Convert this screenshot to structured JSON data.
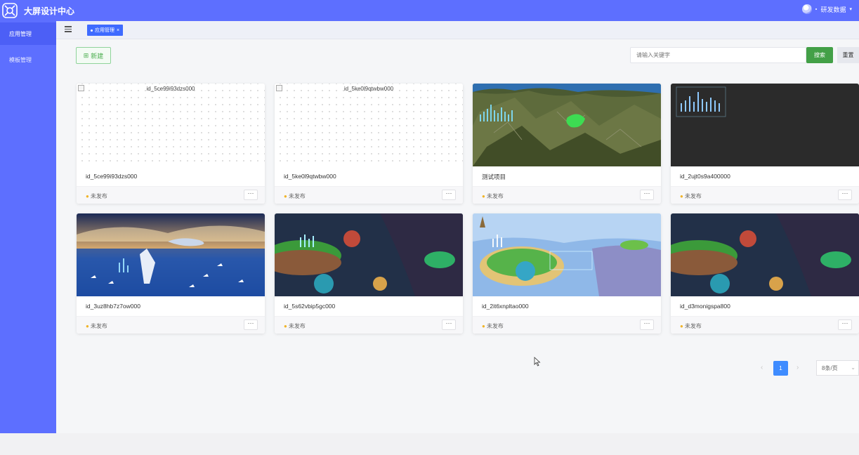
{
  "header": {
    "title": "大屏设计中心",
    "user_name": "研发数据"
  },
  "sidebar": {
    "items": [
      {
        "label": "应用管理",
        "active": true
      },
      {
        "label": "模板管理",
        "active": false
      }
    ]
  },
  "tabs": [
    {
      "label": "应用管理"
    }
  ],
  "toolbar": {
    "new_label": "新建",
    "search_placeholder": "请输入关键字",
    "search_label": "搜索",
    "reset_label": "重置"
  },
  "cards": [
    {
      "name": "id_5ce99i93dzs000",
      "alt": "id_5ce99i93dzs000",
      "status": "未发布",
      "thumb": "broken"
    },
    {
      "name": "id_5ke0l9qtwbw000",
      "alt": "id_5ke0l9qtwbw000",
      "status": "未发布",
      "thumb": "broken"
    },
    {
      "name": "测试项目",
      "status": "未发布",
      "thumb": "mountain"
    },
    {
      "name": "id_2ujt0s9a400000",
      "status": "未发布",
      "thumb": "dark-chart"
    },
    {
      "name": "id_3uz8hb7z7ow000",
      "status": "未发布",
      "thumb": "ocean"
    },
    {
      "name": "id_5s62vbip5gc000",
      "status": "未发布",
      "thumb": "fantasy-green"
    },
    {
      "name": "id_2it6xnpltao000",
      "status": "未发布",
      "thumb": "islands"
    },
    {
      "name": "id_d3monigspa800",
      "status": "未发布",
      "thumb": "fantasy-green"
    }
  ],
  "pagination": {
    "current_page": "1",
    "page_size_label": "8条/页"
  },
  "colors": {
    "brand": "#5d6fff",
    "accent_green": "#43a047",
    "page_blue": "#3f8cff"
  }
}
